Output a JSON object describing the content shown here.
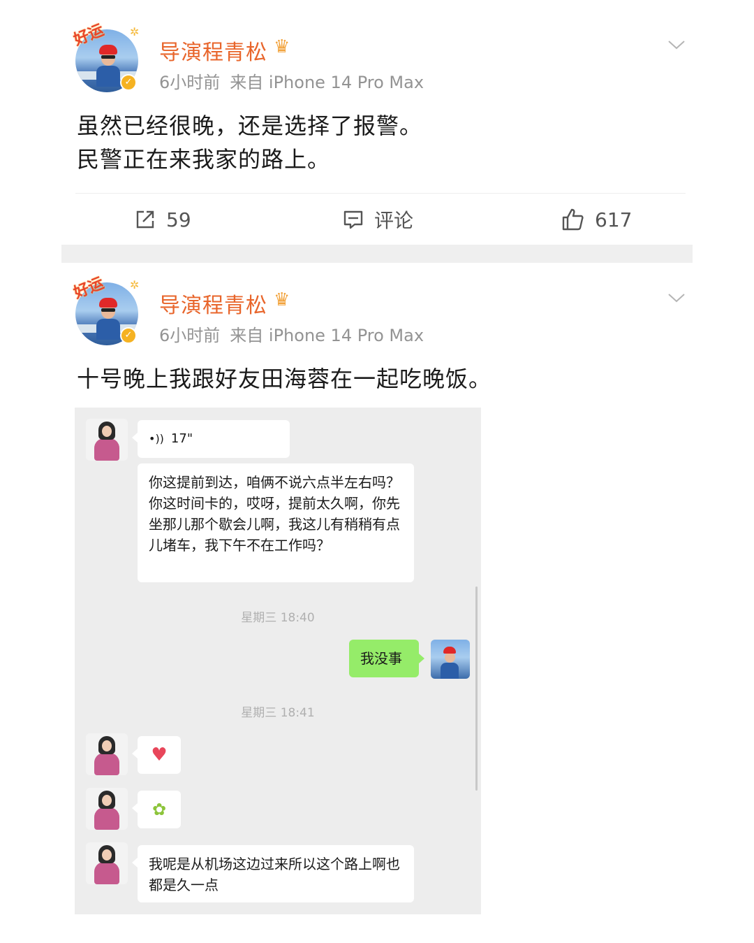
{
  "posts": [
    {
      "author": "导演程青松",
      "avatar_badge": "好运",
      "time": "6小时前",
      "source": "来自 iPhone 14 Pro Max",
      "text_lines": [
        "虽然已经很晚，还是选择了报警。",
        "民警正在来我家的路上。"
      ],
      "actions": {
        "repost": "59",
        "comment": "评论",
        "like": "617"
      }
    },
    {
      "author": "导演程青松",
      "avatar_badge": "好运",
      "time": "6小时前",
      "source": "来自 iPhone 14 Pro Max",
      "text_lines": [
        "十号晚上我跟好友田海蓉在一起吃晚饭。"
      ],
      "chat": {
        "voice_duration": "17\"",
        "message_1": "你这提前到达，咱俩不说六点半左右吗？你这时间卡的，哎呀，提前太久啊，你先坐那儿那个歇会儿啊，我这儿有稍稍有点儿堵车，我下午不在工作吗？",
        "timestamp_1": "星期三 18:40",
        "my_message": "我没事",
        "timestamp_2": "星期三 18:41",
        "emoji_1": "heart",
        "emoji_2": "plant",
        "message_2": "我呢是从机场这边过来所以这个路上啊也都是久一点"
      }
    }
  ],
  "colors": {
    "username": "#e8652b",
    "meta": "#939393",
    "chat_bg": "#ededed",
    "my_bubble": "#95ec69"
  }
}
